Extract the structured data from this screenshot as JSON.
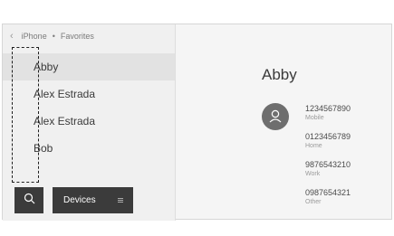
{
  "breadcrumb": {
    "back_icon": "chevron-left-icon",
    "device": "iPhone",
    "separator": "•",
    "section": "Favorites"
  },
  "contacts": [
    {
      "name": "Abby",
      "selected": true
    },
    {
      "name": "Alex Estrada",
      "selected": false
    },
    {
      "name": "Alex Estrada",
      "selected": false
    },
    {
      "name": "Bob",
      "selected": false
    }
  ],
  "bottom_bar": {
    "search_icon": "search-icon",
    "devices_label": "Devices",
    "devices_menu_icon": "menu-icon"
  },
  "detail": {
    "name": "Abby",
    "avatar_icon": "person-icon",
    "numbers": [
      {
        "number": "1234567890",
        "type": "Mobile"
      },
      {
        "number": "0123456789",
        "type": "Home"
      },
      {
        "number": "9876543210",
        "type": "Work"
      },
      {
        "number": "0987654321",
        "type": "Other"
      }
    ]
  },
  "colors": {
    "screen_bg": "#f5f5f5",
    "selected_row": "#e2e2e2",
    "button_bg": "#3b3b3b",
    "avatar_bg": "#6e6e6e",
    "callout_border": "#1f1f1f"
  }
}
